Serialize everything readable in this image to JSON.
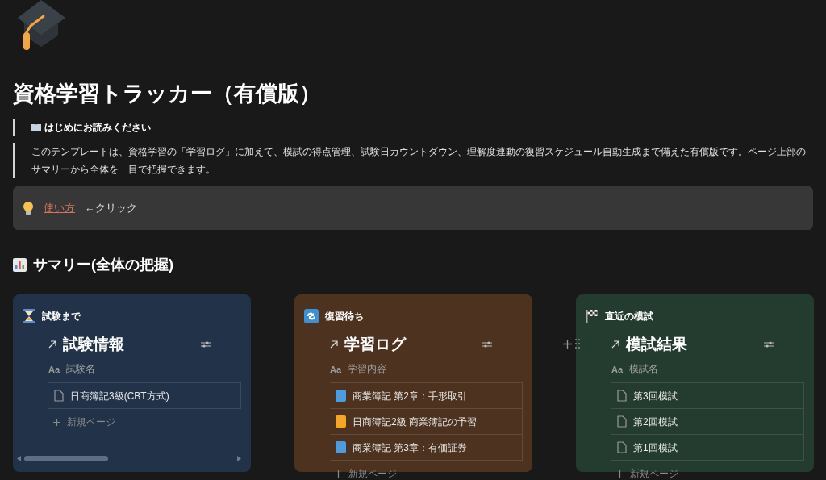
{
  "title": "資格学習トラッカー（有償版）",
  "notice": {
    "heading": "はじめにお読みください",
    "body": "このテンプレートは、資格学習の「学習ログ」に加えて、模試の得点管理、試験日カウントダウン、理解度連動の復習スケジュール自動生成まで備えた有償版です。ページ上部のサマリーから全体を一目で把握できます。"
  },
  "callout": {
    "link": "使い方",
    "text": "←クリック"
  },
  "summary": {
    "heading": "サマリー(全体の把握)"
  },
  "cards": [
    {
      "label": "試験まで",
      "color": "#213249",
      "db_title": "試験情報",
      "column_type": "Aa",
      "column": "試験名",
      "new_page": "新規ページ",
      "scrollbar": true,
      "rows": [
        {
          "kind": "page",
          "text": "日商簿記3級(CBT方式)"
        }
      ]
    },
    {
      "label": "復習待ち",
      "color": "#4d331f",
      "db_title": "学習ログ",
      "column_type": "Aa",
      "column": "学習内容",
      "new_page": "新規ページ",
      "scrollbar": false,
      "rows": [
        {
          "kind": "book",
          "color": "#4a9de0",
          "text": "商業簿記 第2章：手形取引"
        },
        {
          "kind": "book",
          "color": "#f5a623",
          "text": "日商簿記2級 商業簿記の予習"
        },
        {
          "kind": "book",
          "color": "#4a9de0",
          "text": "商業簿記 第3章：有価証券"
        }
      ]
    },
    {
      "label": "直近の模試",
      "color": "#243b2f",
      "db_title": "模試結果",
      "column_type": "Aa",
      "column": "模試名",
      "new_page": "新規ページ",
      "scrollbar": false,
      "handle": true,
      "rows": [
        {
          "kind": "page",
          "text": "第3回模試"
        },
        {
          "kind": "page",
          "text": "第2回模試"
        },
        {
          "kind": "page",
          "text": "第1回模試"
        }
      ]
    }
  ]
}
